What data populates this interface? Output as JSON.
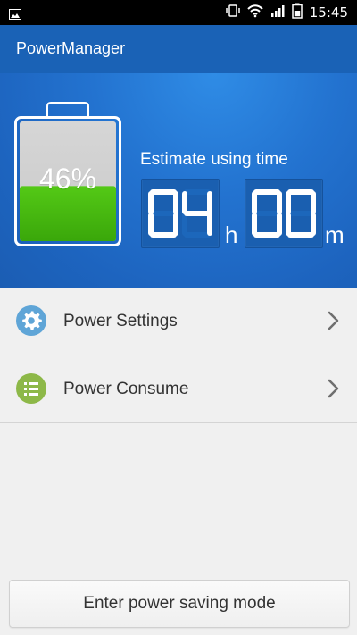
{
  "statusbar": {
    "time": "15:45",
    "icons": [
      "picture-icon",
      "vibrate-icon",
      "wifi-icon",
      "signal-icon",
      "battery-icon"
    ]
  },
  "app": {
    "title": "PowerManager"
  },
  "hero": {
    "battery_percent": "46%",
    "battery_level": 0.46,
    "estimate_label": "Estimate using time",
    "hours": "04",
    "minutes": "00",
    "hours_unit": "h",
    "minutes_unit": "m"
  },
  "menu": [
    {
      "label": "Power Settings",
      "icon": "gear-icon"
    },
    {
      "label": "Power Consume",
      "icon": "list-icon"
    }
  ],
  "actions": {
    "power_saving_label": "Enter power saving mode"
  },
  "colors": {
    "appbar": "#1a62b6",
    "hero": "#2373d0",
    "battery_fill": "#4cc10f",
    "settings_icon": "#5fa5d7",
    "consume_icon": "#8db848"
  }
}
